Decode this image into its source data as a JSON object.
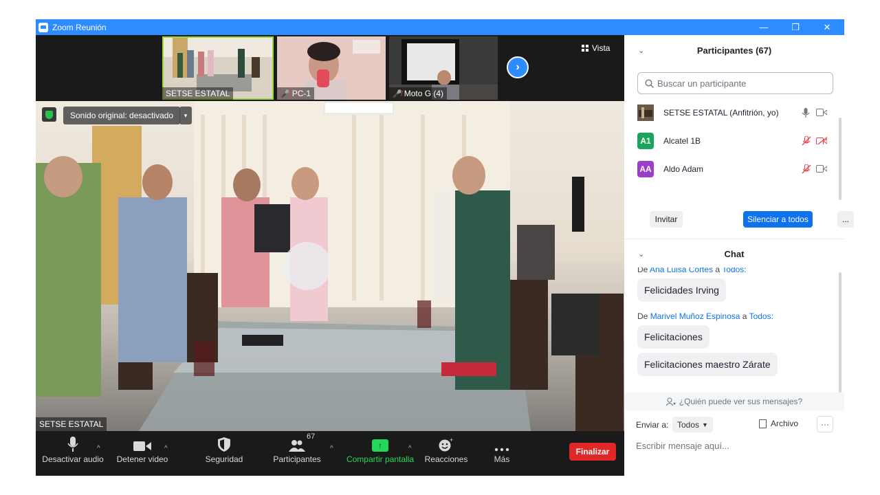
{
  "window": {
    "title": "Zoom Reunión",
    "minimize": "—",
    "restore": "❐",
    "close": "✕"
  },
  "strip": {
    "tiles": [
      {
        "name": "SETSE ESTATAL"
      },
      {
        "name": "PC-1"
      },
      {
        "name": "Moto G (4)"
      }
    ],
    "next": "›",
    "view_label": "Vista"
  },
  "main_video": {
    "sound_label": "Sonido original: desactivado",
    "sound_caret": "▾",
    "speaker_name": "SETSE ESTATAL"
  },
  "toolbar": {
    "mute": "Desactivar audio",
    "video": "Detener video",
    "security": "Seguridad",
    "participants": "Participantes",
    "participants_count": "67",
    "share": "Compartir pantalla",
    "reactions": "Reacciones",
    "more": "Más",
    "end": "Finalizar",
    "caret": "^"
  },
  "participants_panel": {
    "title": "Participantes (67)",
    "collapse": "⌄",
    "search_placeholder": "Buscar un participante",
    "list": [
      {
        "name": "SETSE ESTATAL (Anfitrión, yo)",
        "initials": "",
        "color": "#5a4a3a"
      },
      {
        "name": "Alcatel 1B",
        "initials": "A1",
        "color": "#1aa65a"
      },
      {
        "name": "Aldo Adam",
        "initials": "AA",
        "color": "#9b3fc8"
      }
    ],
    "invite": "Invitar",
    "mute_all": "Silenciar a todos",
    "more": "..."
  },
  "chat": {
    "title": "Chat",
    "collapse": "⌄",
    "from_prefix": "De",
    "to_word": "a",
    "msg1_sender": "Ana Luisa Cortes",
    "msg1_to": "Todos:",
    "msg1_text": "Felicidades Irving",
    "msg2_sender": "Marivel Muñoz Espinosa",
    "msg2_to": "Todos:",
    "msg2_text": "Felicitaciones",
    "msg3_text": "Felicitaciones maestro Zárate",
    "who_can_see": "¿Quién puede ver sus mensajes?",
    "send_to_label": "Enviar a:",
    "send_to_value": "Todos",
    "file_label": "Archivo",
    "more": "···",
    "compose_placeholder": "Escribir mensaje aquí..."
  }
}
